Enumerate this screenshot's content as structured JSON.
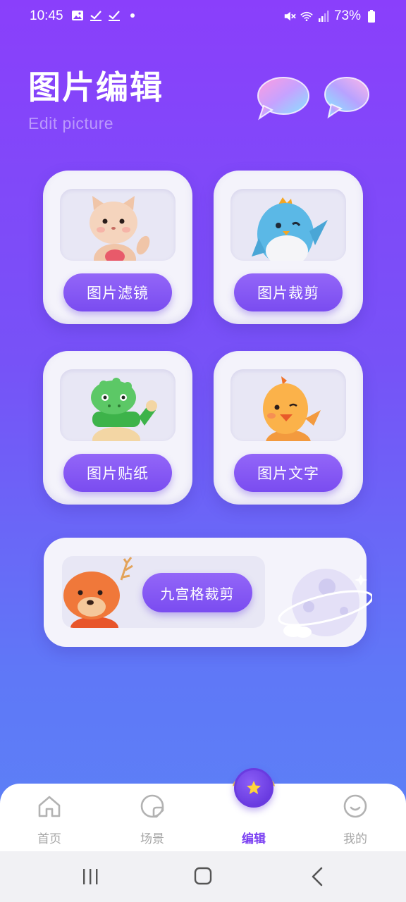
{
  "status_bar": {
    "time": "10:45",
    "battery": "73%",
    "icons_left": [
      "image-icon",
      "check-icon",
      "check-icon",
      "dot-icon"
    ],
    "icons_right": [
      "mute-icon",
      "wifi-icon",
      "signal-icon",
      "battery-icon"
    ]
  },
  "header": {
    "title": "图片编辑",
    "subtitle": "Edit picture"
  },
  "cards": [
    {
      "label": "图片滤镜",
      "icon": "cat-mascot"
    },
    {
      "label": "图片裁剪",
      "icon": "penguin-mascot"
    },
    {
      "label": "图片贴纸",
      "icon": "crocodile-mascot"
    },
    {
      "label": "图片文字",
      "icon": "chick-mascot"
    }
  ],
  "wide_card": {
    "label": "九宫格裁剪",
    "icon": "deer-mascot"
  },
  "bottom_nav": {
    "items": [
      {
        "label": "首页",
        "icon": "home-icon"
      },
      {
        "label": "场景",
        "icon": "scene-icon"
      },
      {
        "label": "编辑",
        "icon": "star-icon",
        "active": true
      },
      {
        "label": "我的",
        "icon": "smile-icon"
      }
    ]
  },
  "colors": {
    "accent": "#7a3ff2",
    "button": "#8a5cf5",
    "card_bg": "#f4f3fb",
    "gradient_top": "#8a3ffb",
    "gradient_bottom": "#5b84f6"
  }
}
